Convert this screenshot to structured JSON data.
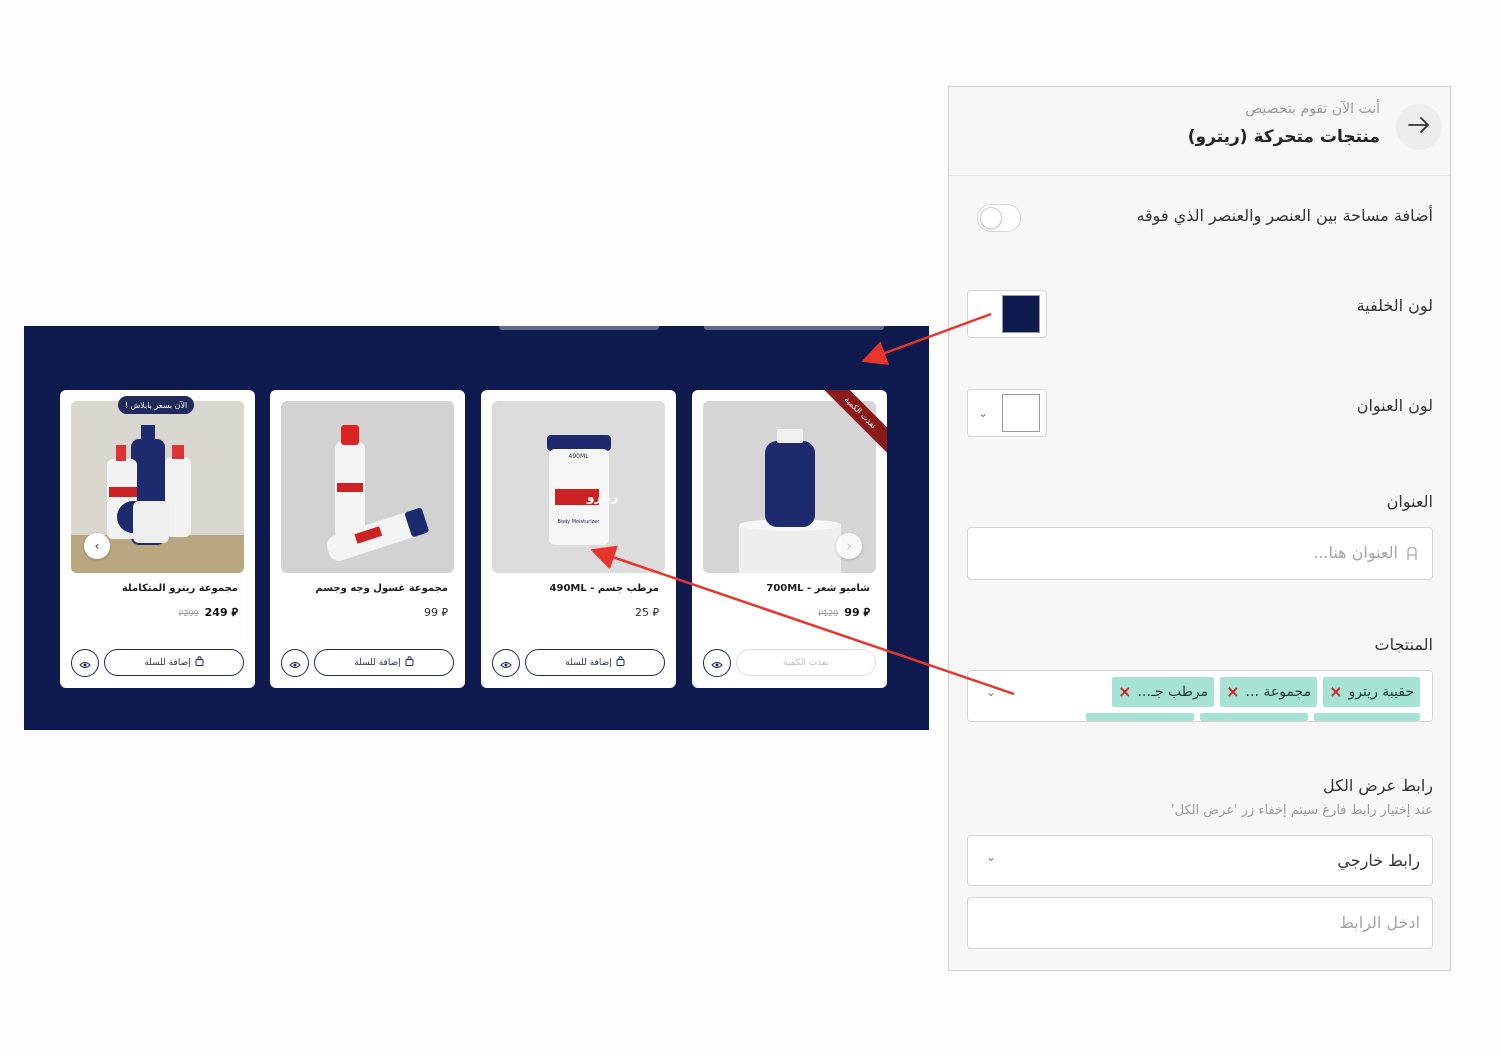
{
  "preview": {
    "background": "#0f1a4f",
    "currency": "⃁",
    "cards": [
      {
        "name": "شامبو شعر - 700ML",
        "price_now": "99",
        "price_old": "129",
        "button": "نفذت الكمية",
        "ribbon": "نفذت الكمية",
        "button_disabled": true
      },
      {
        "name": "مرطب جسم - 490ML",
        "price_now": "25",
        "button": "إضافة للسلة"
      },
      {
        "name": "مجموعة غسول وجه وجسم",
        "price_now": "99",
        "button": "إضافة للسلة"
      },
      {
        "name": "مجموعة ريترو المتكاملة",
        "price_now": "249",
        "price_old": "299",
        "button": "إضافة للسلة",
        "promo": "الآن بسعر بابلاش !"
      }
    ],
    "product_label_a": "ريترو",
    "product_label_b": "Body Moisturizer",
    "product_label_c": "490ML"
  },
  "panel": {
    "subtitle": "أنت الآن تقوم بتخصيص",
    "title": "منتجات متحركة (ريترو)",
    "spacing_label": "أضافة مساحة بين العنصر والعنصر الذي فوقه",
    "spacing_enabled": false,
    "bg_color_label": "لون الخلفية",
    "bg_color_value": "#0f1a4f",
    "title_color_label": "لون العنوان",
    "title_color_value": "#ffffff",
    "title_label": "العنوان",
    "title_placeholder": "العنوان هنا...",
    "products_label": "المنتجات",
    "product_tags": [
      "حقيبة ريترو",
      "مجموعة ...",
      "مرطب جـ..."
    ],
    "view_all_label": "رابط عرض الكل",
    "view_all_hint": "عند إختيار رابط فارغ سيتم إخفاء زر 'عرض الكل'",
    "link_type_value": "رابط خارجي",
    "link_placeholder": "ادخل الرابط"
  },
  "colors": {
    "arrow": "#e8352b",
    "accent_navy": "#1f2a5c",
    "tag_bg": "#a6e3d4",
    "remove_x": "#d42222"
  }
}
